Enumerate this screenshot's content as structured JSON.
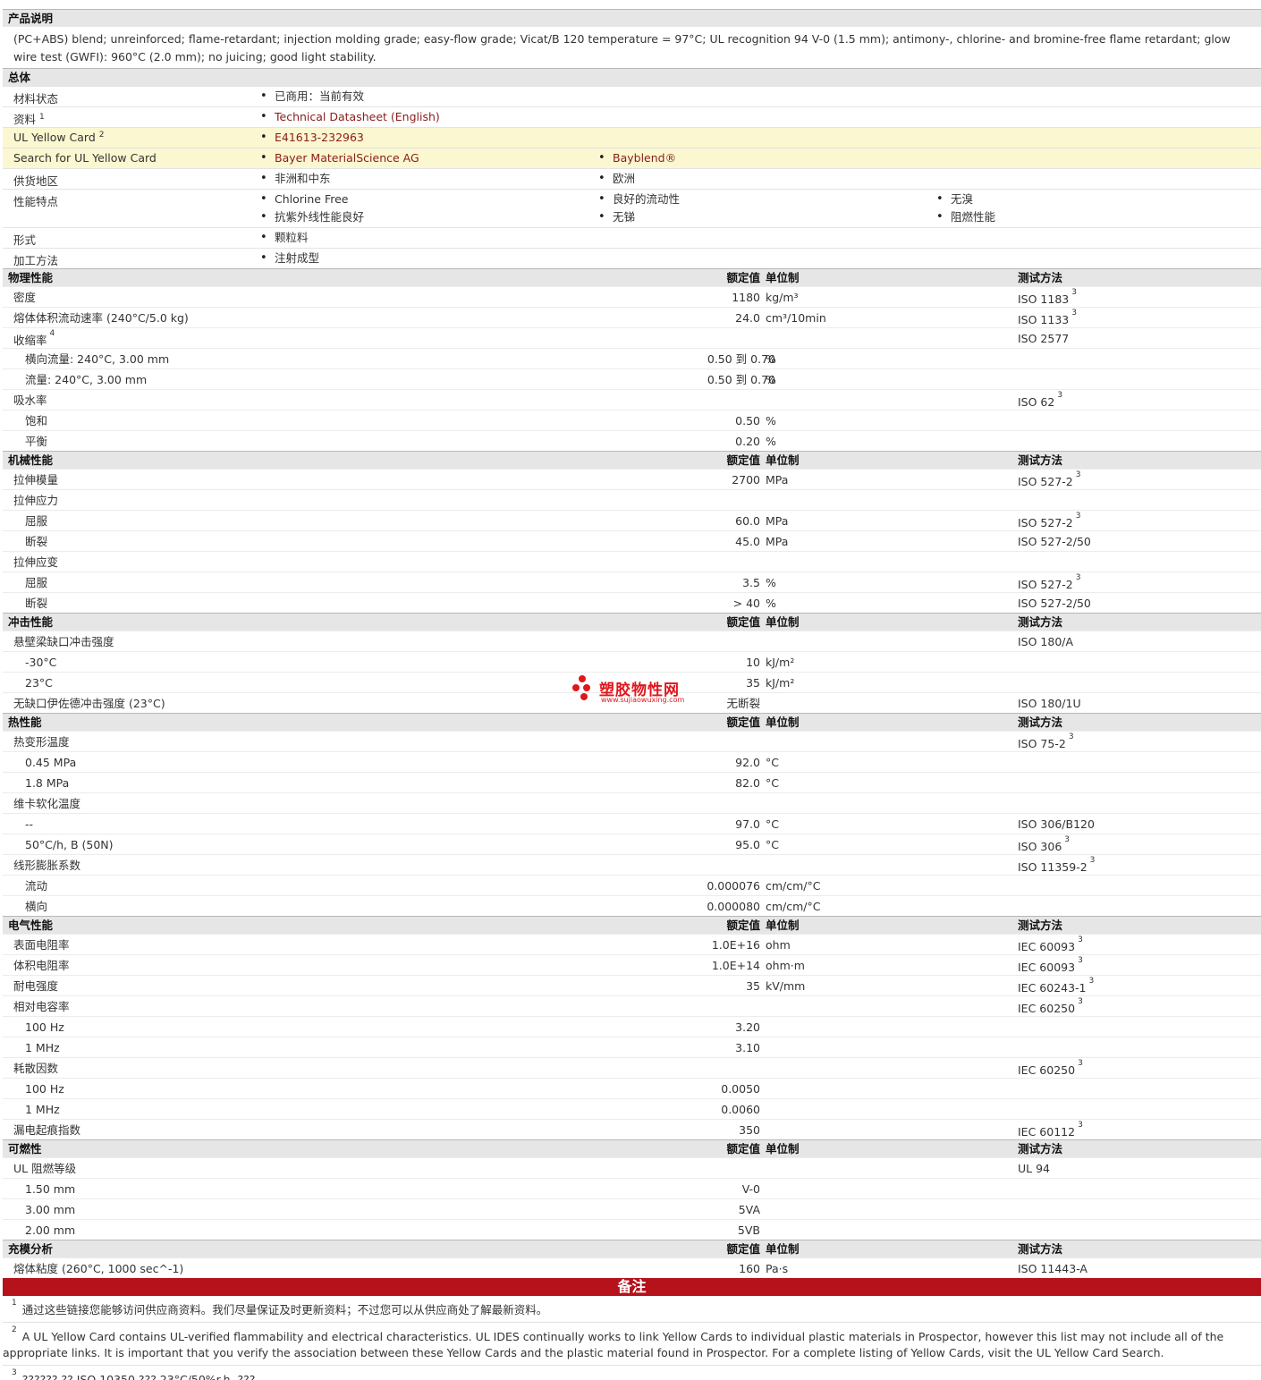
{
  "description": {
    "heading": "产品说明",
    "text": "(PC+ABS) blend; unreinforced; flame-retardant; injection molding grade; easy-flow grade; Vicat/B 120 temperature = 97°C; UL recognition 94 V-0 (1.5 mm); antimony-, chlorine- and bromine-free flame retardant; glow wire test (GWFI): 960°C (2.0 mm); no juicing; good light stability."
  },
  "general": {
    "heading": "总体",
    "rows": [
      {
        "label": "材料状态",
        "sup": "",
        "items": [
          "已商用：当前有效"
        ]
      },
      {
        "label": "资料",
        "sup": "1",
        "items": [
          "Technical Datasheet (English)"
        ]
      },
      {
        "label": "UL Yellow Card",
        "sup": "2",
        "items": [
          "E41613-232963"
        ]
      },
      {
        "label": "Search for UL Yellow Card",
        "sup": "",
        "items": [
          "Bayer MaterialScience AG",
          "Bayblend®"
        ]
      },
      {
        "label": "供货地区",
        "sup": "",
        "items": [
          "非洲和中东",
          "欧洲"
        ]
      },
      {
        "label": "性能特点",
        "sup": "",
        "items": [
          "Chlorine Free",
          "良好的流动性",
          "无溴",
          "抗紫外线性能良好",
          "无锑",
          "阻燃性能"
        ]
      },
      {
        "label": "形式",
        "sup": "",
        "items": [
          "颗粒料"
        ]
      },
      {
        "label": "加工方法",
        "sup": "",
        "items": [
          "注射成型"
        ]
      }
    ]
  },
  "col_headers": {
    "value": "额定值",
    "unit": "单位制",
    "method": "测试方法"
  },
  "sections": [
    {
      "title": "物理性能",
      "rows": [
        {
          "name": "密度",
          "value": "1180",
          "unit": "kg/m³",
          "method": "ISO 1183",
          "ref": "3"
        },
        {
          "name": "熔体体积流动速率 (240°C/5.0 kg)",
          "value": "24.0",
          "unit": "cm³/10min",
          "method": "ISO 1133",
          "ref": "3"
        },
        {
          "name": "收缩率",
          "nameSup": "4",
          "method": "ISO 2577"
        },
        {
          "name": "横向流量: 240°C, 3.00 mm",
          "sub": true,
          "value": "0.50 到  0.70",
          "range": true,
          "unit": "%"
        },
        {
          "name": "流量: 240°C, 3.00 mm",
          "sub": true,
          "value": "0.50 到  0.70",
          "range": true,
          "unit": "%"
        },
        {
          "name": "吸水率",
          "method": "ISO 62",
          "ref": "3"
        },
        {
          "name": "饱和",
          "sub": true,
          "value": "0.50",
          "unit": "%"
        },
        {
          "name": "平衡",
          "sub": true,
          "value": "0.20",
          "unit": "%"
        }
      ]
    },
    {
      "title": "机械性能",
      "rows": [
        {
          "name": "拉伸模量",
          "value": "2700",
          "unit": "MPa",
          "method": "ISO 527-2",
          "ref": "3"
        },
        {
          "name": "拉伸应力"
        },
        {
          "name": "屈服",
          "sub": true,
          "value": "60.0",
          "unit": "MPa",
          "method": "ISO 527-2",
          "ref": "3"
        },
        {
          "name": "断裂",
          "sub": true,
          "value": "45.0",
          "unit": "MPa",
          "method": "ISO 527-2/50"
        },
        {
          "name": "拉伸应变"
        },
        {
          "name": "屈服",
          "sub": true,
          "value": "3.5",
          "unit": "%",
          "method": "ISO 527-2",
          "ref": "3"
        },
        {
          "name": "断裂",
          "sub": true,
          "value": "> 40",
          "unit": "%",
          "method": "ISO 527-2/50"
        }
      ]
    },
    {
      "title": "冲击性能",
      "rows": [
        {
          "name": "悬壁梁缺口冲击强度",
          "method": "ISO 180/A"
        },
        {
          "name": "-30°C",
          "sub": true,
          "value": "10",
          "unit": "kJ/m²"
        },
        {
          "name": "23°C",
          "sub": true,
          "value": "35",
          "unit": "kJ/m²"
        },
        {
          "name": "无缺口伊佐德冲击强度 (23°C)",
          "value": "无断裂",
          "method": "ISO 180/1U"
        }
      ]
    },
    {
      "title": "热性能",
      "rows": [
        {
          "name": "热变形温度",
          "method": "ISO 75-2",
          "ref": "3"
        },
        {
          "name": "0.45 MPa",
          "sub": true,
          "value": "92.0",
          "unit": "°C"
        },
        {
          "name": "1.8 MPa",
          "sub": true,
          "value": "82.0",
          "unit": "°C"
        },
        {
          "name": "维卡软化温度"
        },
        {
          "name": "--",
          "sub": true,
          "value": "97.0",
          "unit": "°C",
          "method": "ISO 306/B120"
        },
        {
          "name": "50°C/h, B (50N)",
          "sub": true,
          "value": "95.0",
          "unit": "°C",
          "method": "ISO 306",
          "ref": "3"
        },
        {
          "name": "线形膨胀系数",
          "method": "ISO 11359-2",
          "ref": "3"
        },
        {
          "name": "流动",
          "sub": true,
          "value": "0.000076",
          "unit": "cm/cm/°C"
        },
        {
          "name": "横向",
          "sub": true,
          "value": "0.000080",
          "unit": "cm/cm/°C"
        }
      ]
    },
    {
      "title": "电气性能",
      "rows": [
        {
          "name": "表面电阻率",
          "value": "1.0E+16",
          "unit": "ohm",
          "method": "IEC 60093",
          "ref": "3"
        },
        {
          "name": "体积电阻率",
          "value": "1.0E+14",
          "unit": "ohm·m",
          "method": "IEC 60093",
          "ref": "3"
        },
        {
          "name": "耐电强度",
          "value": "35",
          "unit": "kV/mm",
          "method": "IEC 60243-1",
          "ref": "3"
        },
        {
          "name": "相对电容率",
          "method": "IEC 60250",
          "ref": "3"
        },
        {
          "name": "100 Hz",
          "sub": true,
          "value": "3.20"
        },
        {
          "name": "1 MHz",
          "sub": true,
          "value": "3.10"
        },
        {
          "name": "耗散因数",
          "method": "IEC 60250",
          "ref": "3"
        },
        {
          "name": "100 Hz",
          "sub": true,
          "value": "0.0050"
        },
        {
          "name": "1 MHz",
          "sub": true,
          "value": "0.0060"
        },
        {
          "name": "漏电起痕指数",
          "value": "350",
          "method": "IEC 60112",
          "ref": "3"
        }
      ]
    },
    {
      "title": "可燃性",
      "rows": [
        {
          "name": "UL 阻燃等级",
          "method": "UL 94"
        },
        {
          "name": "1.50 mm",
          "sub": true,
          "value": "V-0"
        },
        {
          "name": "3.00 mm",
          "sub": true,
          "value": "5VA"
        },
        {
          "name": "2.00 mm",
          "sub": true,
          "value": "5VB"
        }
      ]
    },
    {
      "title": "充模分析",
      "rows": [
        {
          "name": "熔体粘度 (260°C, 1000 sec^-1)",
          "value": "160",
          "unit": "Pa·s",
          "method": "ISO 11443-A"
        }
      ]
    }
  ],
  "notes": {
    "title": "备注",
    "items": [
      {
        "num": "1",
        "text": "通过这些链接您能够访问供应商资料。我们尽量保证及时更新资料；不过您可以从供应商处了解最新资料。"
      },
      {
        "num": "2",
        "text": "A UL Yellow Card contains UL-verified flammability and electrical characteristics. UL IDES continually works to link Yellow Cards to individual plastic materials in Prospector, however this list may not include all of the appropriate links. It is important that you verify the association between these Yellow Cards and the plastic material found in Prospector. For a complete listing of Yellow Cards, visit the UL Yellow Card Search."
      },
      {
        "num": "3",
        "text": "??????,?? ISO 10350 ??? 23°C/50%r.h. ???"
      },
      {
        "num": "4",
        "text": ""
      }
    ]
  },
  "watermark": {
    "title": "塑胶物性网",
    "url": "www.sujiaowuxing.com",
    "color": "#e0161d"
  },
  "colors": {
    "section_bg": "#e6e6e6",
    "yellow_row": "#fbf7d0",
    "notes_bar": "#b5121b",
    "link": "#8a1c1c"
  }
}
